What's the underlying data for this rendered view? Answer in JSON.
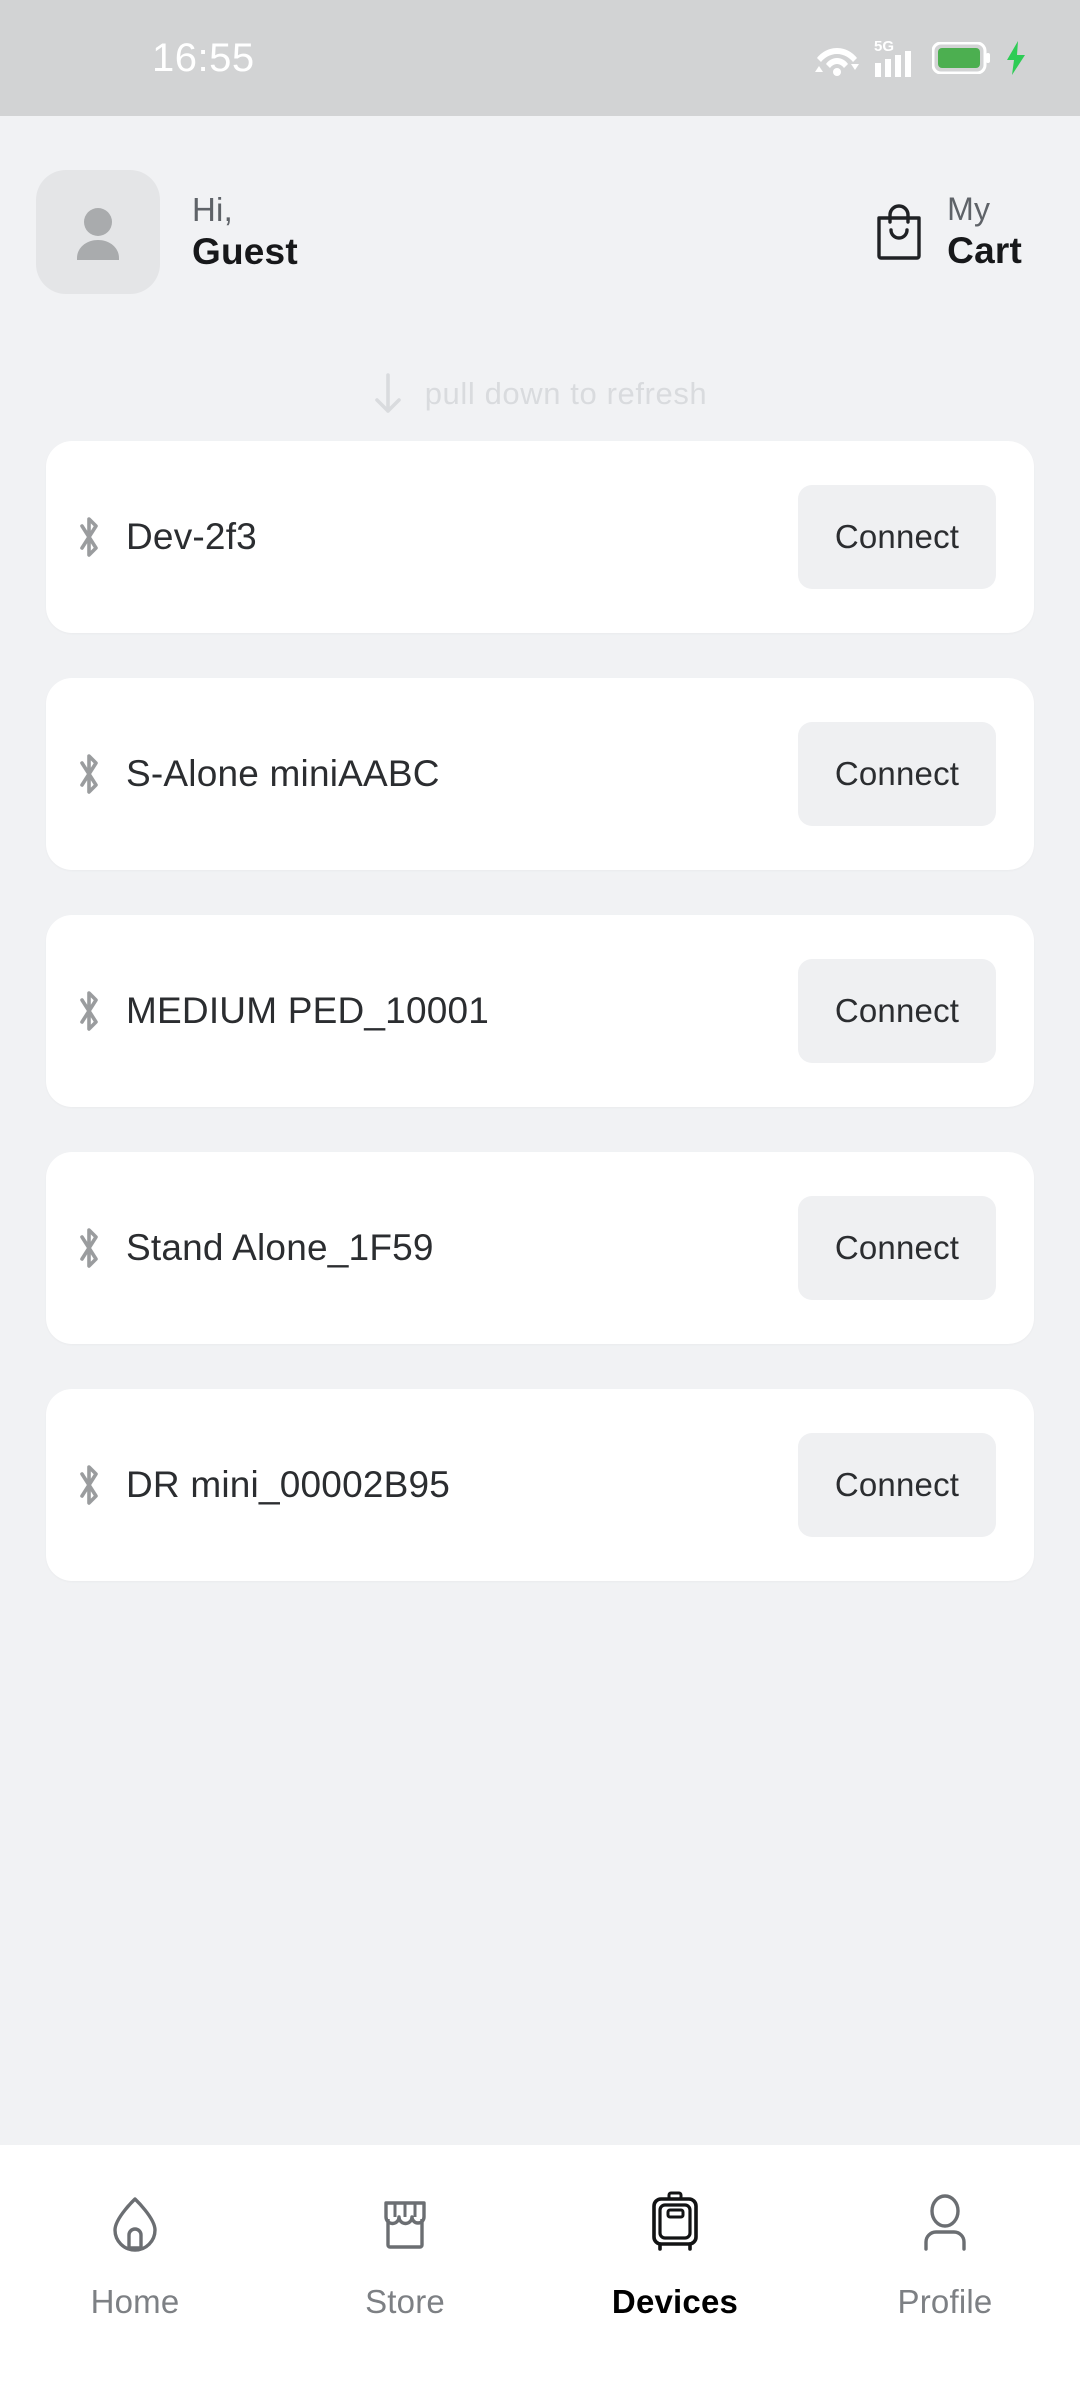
{
  "status_bar": {
    "time": "16:55",
    "network_label": "5G",
    "icons": [
      "wifi-icon",
      "signal-5g-icon",
      "battery-icon",
      "charging-bolt-icon"
    ],
    "battery_color": "#4caf50",
    "background": "#d2d3d4"
  },
  "header": {
    "avatar_icon": "person-avatar-icon",
    "greeting": "Hi,",
    "user_name": "Guest",
    "cart_icon": "shopping-bag-icon",
    "cart_line1": "My",
    "cart_line2": "Cart"
  },
  "refresh": {
    "icon": "arrow-down-icon",
    "text": "pull down to refresh",
    "color": "#d9dbde"
  },
  "devices": {
    "item_icon": "bluetooth-icon",
    "action_label": "Connect",
    "items": [
      {
        "name": "Dev-2f3"
      },
      {
        "name": "S-Alone miniAABC"
      },
      {
        "name": "MEDIUM PED_10001"
      },
      {
        "name": "Stand Alone_1F59"
      },
      {
        "name": "DR mini_00002B95"
      }
    ]
  },
  "bottom_nav": {
    "active_index": 2,
    "items": [
      {
        "label": "Home",
        "icon": "home-icon"
      },
      {
        "label": "Store",
        "icon": "store-icon"
      },
      {
        "label": "Devices",
        "icon": "terminal-device-icon"
      },
      {
        "label": "Profile",
        "icon": "person-icon"
      }
    ]
  }
}
